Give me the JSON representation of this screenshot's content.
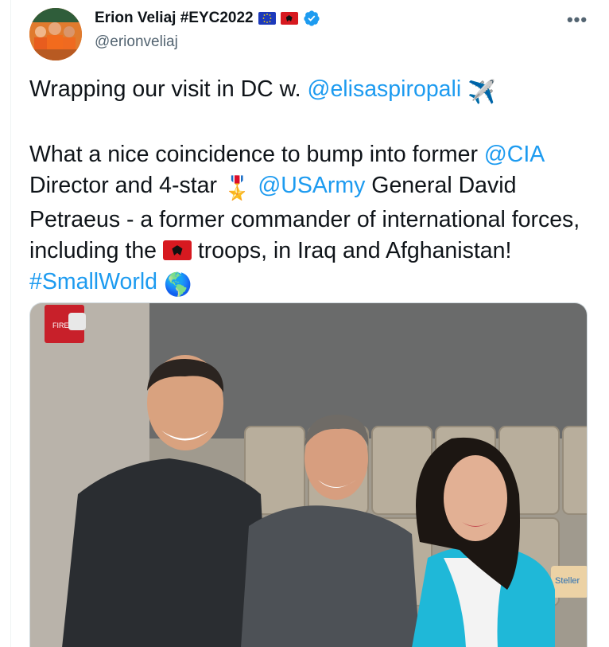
{
  "author": {
    "name": "Erion Veliaj #EYC2022",
    "handle": "@erionveliaj",
    "flags": [
      "eu-flag-icon",
      "albania-flag-icon"
    ],
    "verified_icon": "verified-badge-icon"
  },
  "menu": {
    "icon": "more-options-icon",
    "label": "•••"
  },
  "tweet": {
    "line1_text": "Wrapping our visit in DC w. ",
    "line1_mention": "@elisaspiropali",
    "line1_emoji": "✈️",
    "p2_mention1": "@CIA",
    "p2_text1": " Director and 4-star ",
    "p2_emoji1": "🎖️",
    "p2_mention2": "@USArmy",
    "p2_text2": " General David Petraeus - a former commander of international forces, including the ",
    "p2_text3": " troops, in Iraq and Afghanistan! ",
    "p2_hashtag": "#SmallWorld",
    "p2_emoji2": "🌎",
    "p2_text0": "What a nice coincidence to bump into former "
  },
  "photo": {
    "sign_text": "FIRE",
    "sticker_text": "Steller"
  },
  "colors": {
    "link": "#1d9bf0",
    "muted": "#536471",
    "text": "#0f1419"
  }
}
